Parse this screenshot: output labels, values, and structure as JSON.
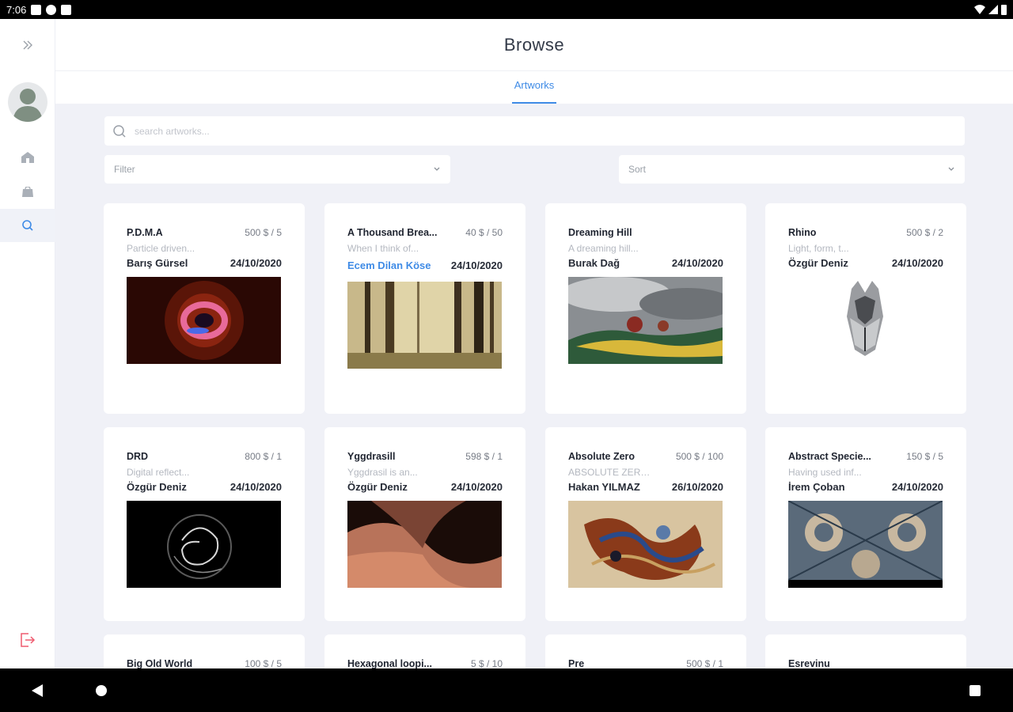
{
  "status_bar": {
    "time": "7:06"
  },
  "header": {
    "title": "Browse"
  },
  "tabs": [
    {
      "label": "Artworks"
    }
  ],
  "search": {
    "placeholder": "search artworks..."
  },
  "filter": {
    "label": "Filter"
  },
  "sort": {
    "label": "Sort"
  },
  "colors": {
    "accent": "#3f8be6",
    "background": "#f0f1f7",
    "logout": "#ef5a6f"
  },
  "icons": {
    "expand": "chevrons-right-icon",
    "home": "home-icon",
    "store": "store-icon",
    "search": "search-icon",
    "logout": "logout-icon"
  },
  "cards": [
    {
      "title": "P.D.M.A",
      "price": "500 $ / 5",
      "desc": "Particle driven...",
      "artist": "Barış Gürsel",
      "date": "24/10/2020",
      "artist_link": false
    },
    {
      "title": "A Thousand Brea...",
      "price": "40 $ / 50",
      "desc": "When I think of...",
      "artist": "Ecem Dilan Köse",
      "date": "24/10/2020",
      "artist_link": true
    },
    {
      "title": "Dreaming Hill",
      "price": "",
      "desc": "A dreaming hill...",
      "artist": "Burak Dağ",
      "date": "24/10/2020",
      "artist_link": false
    },
    {
      "title": "Rhino",
      "price": "500 $ / 2",
      "desc": "Light, form, t...",
      "artist": "Özgür Deniz",
      "date": "24/10/2020",
      "artist_link": false
    },
    {
      "title": "DRD",
      "price": "800 $ / 1",
      "desc": "Digital reflect...",
      "artist": "Özgür Deniz",
      "date": "24/10/2020",
      "artist_link": false
    },
    {
      "title": "Yggdrasill",
      "price": "598 $ / 1",
      "desc": "Yggdrasil is an...",
      "artist": "Özgür Deniz",
      "date": "24/10/2020",
      "artist_link": false
    },
    {
      "title": "Absolute Zero",
      "price": "500 $ / 100",
      "desc": "ABSOLUTE ZERO i...",
      "artist": "Hakan YILMAZ",
      "date": "26/10/2020",
      "artist_link": false
    },
    {
      "title": "Abstract Specie...",
      "price": "150 $ / 5",
      "desc": "Having used inf...",
      "artist": "İrem Çoban",
      "date": "24/10/2020",
      "artist_link": false
    },
    {
      "title": "Big Old World",
      "price": "100 $ / 5",
      "desc": "",
      "artist": "",
      "date": "",
      "artist_link": false
    },
    {
      "title": "Hexagonal loopi...",
      "price": "5 $ / 10",
      "desc": "",
      "artist": "",
      "date": "",
      "artist_link": false
    },
    {
      "title": "Pre",
      "price": "500 $ / 1",
      "desc": "",
      "artist": "",
      "date": "",
      "artist_link": false
    },
    {
      "title": "Esrevinu",
      "price": "",
      "desc": "",
      "artist": "",
      "date": "",
      "artist_link": false
    }
  ]
}
